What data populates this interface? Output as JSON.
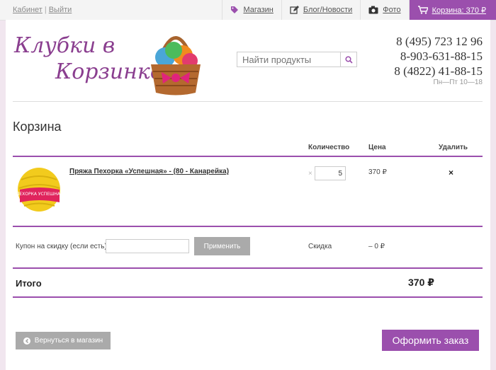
{
  "topbar": {
    "account_link": "Кабинет",
    "separator": "|",
    "logout_link": "Выйти",
    "nav": [
      {
        "label": "Магазин",
        "icon": "tag-icon"
      },
      {
        "label": "Блог/Новости",
        "icon": "edit-icon"
      },
      {
        "label": "Фото",
        "icon": "camera-icon"
      }
    ],
    "cart_label": "Корзина: 370 ₽",
    "cart_icon": "cart-icon"
  },
  "header": {
    "logo_text": "Клубки в Корзинке",
    "search_placeholder": "Найти продукты",
    "phones": [
      "8 (495) 723 12 96",
      "8-903-631-88-15",
      "8 (4822) 41-88-15"
    ],
    "hours": "Пн—Пт 10—18"
  },
  "cart": {
    "title": "Корзина",
    "columns": {
      "quantity": "Количество",
      "price": "Цена",
      "remove": "Удалить"
    },
    "items": [
      {
        "name": "Пряжа Пехорка «Успешная» - (80 - Канарейка)",
        "qty_prefix": "×",
        "qty": "5",
        "price": "370 ₽",
        "remove": "×",
        "image_label": "ПЕХОРКА УСПЕШНАЯ"
      }
    ],
    "coupon_label": "Купон на скидку (если есть):",
    "coupon_value": "",
    "apply_label": "Применить",
    "discount_label": "Скидка",
    "discount_value": "– 0 ₽",
    "total_label": "Итого",
    "total_value": "370 ₽",
    "back_label": "Вернуться в магазин",
    "checkout_label": "Оформить заказ"
  },
  "colors": {
    "accent": "#9b4fad",
    "background": "#f1e6ef",
    "gray_button": "#aaaaaa"
  }
}
